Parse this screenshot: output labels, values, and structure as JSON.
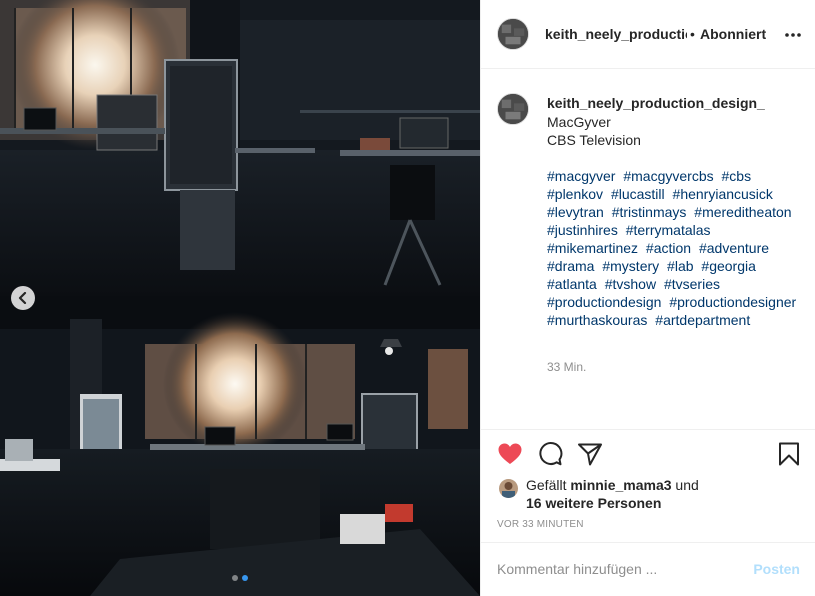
{
  "colors": {
    "like_red": "#ed4956",
    "link_blue": "#00376b",
    "accent_blue": "#3897f0",
    "post_button_disabled": "#b2dffc",
    "muted_gray": "#8e8e8e"
  },
  "media": {
    "top_photo_icon": "lab-set-panorama",
    "bottom_photo_icon": "lab-set-panorama",
    "prev_icon": "chevron-left-icon",
    "carousel_count": 2,
    "carousel_active_index": 1
  },
  "header": {
    "username": "keith_neely_production_design_",
    "separator": "•",
    "follow_status": "Abonniert",
    "more_icon": "more-horizontal-icon"
  },
  "caption": {
    "username": "keith_neely_production_design_",
    "lines": [
      "MacGyver",
      "CBS Television"
    ],
    "hashtags": [
      "#macgyver",
      "#macgyvercbs",
      "#cbs",
      "#plenkov",
      "#lucastill",
      "#henryiancusick",
      "#levytran",
      "#tristinmays",
      "#mereditheaton",
      "#justinhires",
      "#terrymatalas",
      "#mikemartinez",
      "#action",
      "#adventure",
      "#drama",
      "#mystery",
      "#lab",
      "#georgia",
      "#atlanta",
      "#tvshow",
      "#tvseries",
      "#productiondesign",
      "#productiondesigner",
      "#murthaskouras",
      "#artdepartment"
    ],
    "relative_time": "33 Min."
  },
  "actions": {
    "like_icon": "heart-filled-icon",
    "comment_icon": "comment-icon",
    "share_icon": "paper-plane-icon",
    "save_icon": "bookmark-icon"
  },
  "likes": {
    "prefix": "Gefällt",
    "user": "minnie_mama3",
    "conjunction": "und",
    "others": "16 weitere Personen"
  },
  "post_time": "VOR 33 MINUTEN",
  "comment": {
    "placeholder": "Kommentar hinzufügen ...",
    "post_label": "Posten"
  }
}
